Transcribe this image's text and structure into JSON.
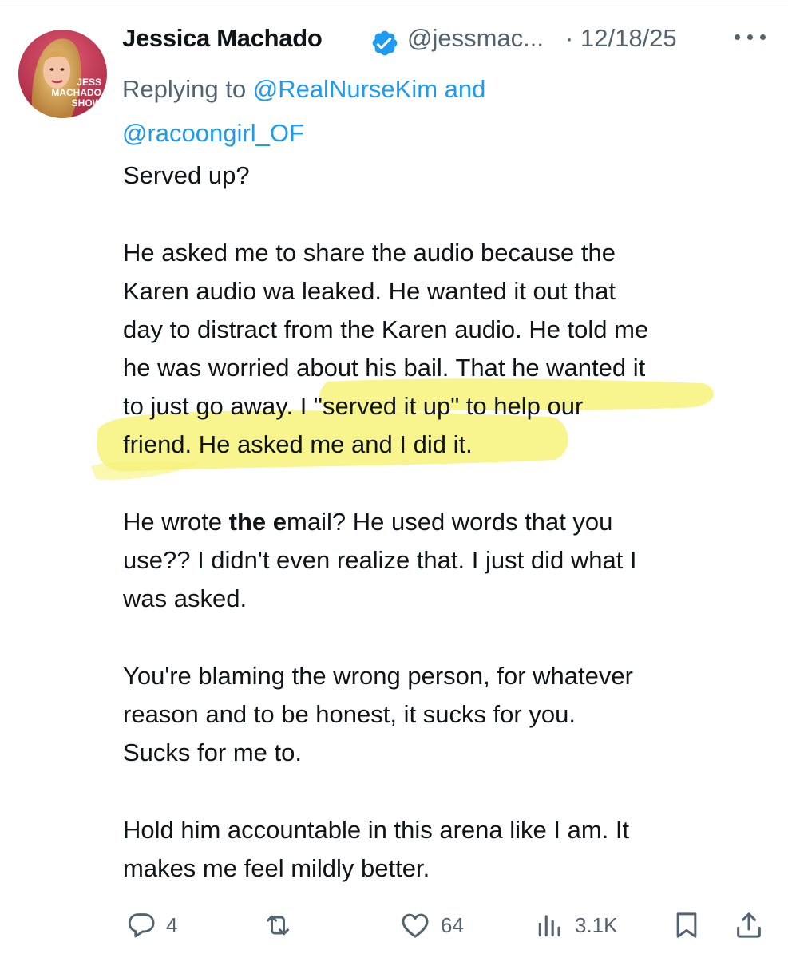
{
  "tweet": {
    "author": {
      "name": "Jessica Machado",
      "handle": "@jessmac...",
      "verified": true,
      "avatar_text": [
        "JESS",
        "MACHADO",
        "SHOW"
      ]
    },
    "separator": "·",
    "date": "12/18/25",
    "more_icon": "more-horizontal-icon",
    "replying": {
      "prefix": "Replying to ",
      "mention_1": "@RealNurseKim",
      "conjunction": " and",
      "mention_2": "@racoongirl_OF"
    },
    "body": {
      "p1": "Served up?",
      "p2": {
        "l1": "He asked me to share the audio because the",
        "l2": "Karen audio wa leaked. He wanted it out that",
        "l3": "day to distract from the Karen audio. He told me",
        "l4": "he was worried about his bail. That he wanted it",
        "l5": "to just go away. I \"served it up\" to help our",
        "l6": "friend. He asked me and I did it."
      },
      "p3": {
        "l1_before": "He wrote ",
        "l1_bold": "the e",
        "l1_after": "mail? He used words that you",
        "l2": "use?? I didn't even realize that.  I just did what I",
        "l3": "was asked."
      },
      "p4": {
        "l1": "You're blaming the wrong person, for whatever",
        "l2": "reason and to be honest,  it sucks for you.",
        "l3": "Sucks for me to."
      },
      "p5": {
        "l1": "Hold him accountable in this arena like I am. It",
        "l2": "makes me feel mildly better."
      }
    },
    "highlight_color": "#f7f27a",
    "actions": {
      "replies": {
        "icon": "reply-icon",
        "count": "4"
      },
      "reposts": {
        "icon": "repost-icon",
        "count": ""
      },
      "likes": {
        "icon": "heart-icon",
        "count": "64"
      },
      "views": {
        "icon": "views-icon",
        "count": "3.1K"
      },
      "bookmark": {
        "icon": "bookmark-icon"
      },
      "share": {
        "icon": "share-icon"
      }
    },
    "colors": {
      "text": "#0f1419",
      "secondary": "#536471",
      "link": "#1d9bf0",
      "verified": "#1d9bf0"
    }
  }
}
